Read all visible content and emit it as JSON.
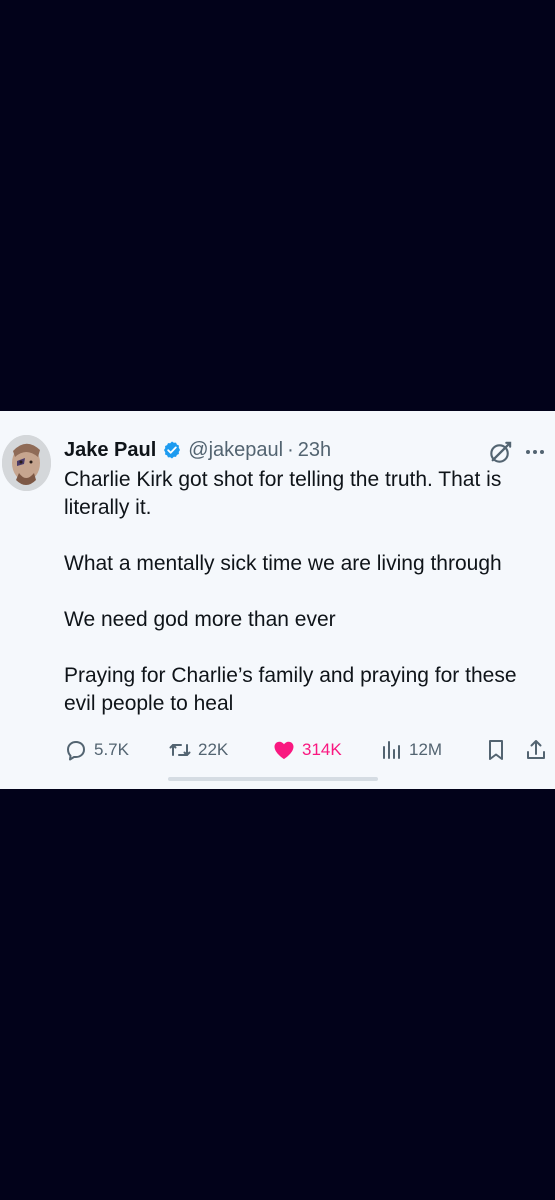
{
  "tweet": {
    "author_name": "Jake Paul",
    "author_handle": "@jakepaul",
    "separator": "·",
    "timestamp": "23h",
    "text_lines": [
      "Charlie Kirk got shot for telling the truth. That is literally it.",
      "What a mentally sick time we are living through",
      "We need god more than ever",
      "Praying for Charlie’s family and praying for these evil people to heal"
    ],
    "stats": {
      "replies": "5.7K",
      "reposts": "22K",
      "likes": "314K",
      "views": "12M"
    },
    "icons": {
      "verified": "verified-badge-icon",
      "grok": "grok-icon",
      "more": "more-icon",
      "reply": "reply-icon",
      "repost": "repost-icon",
      "like": "heart-icon",
      "views": "views-icon",
      "bookmark": "bookmark-icon",
      "share": "share-icon"
    },
    "colors": {
      "background": "#02021a",
      "card": "#f5f8fc",
      "text": "#0f1419",
      "secondary_text": "#536471",
      "verified": "#1d9bf0",
      "like": "#f91880"
    }
  }
}
